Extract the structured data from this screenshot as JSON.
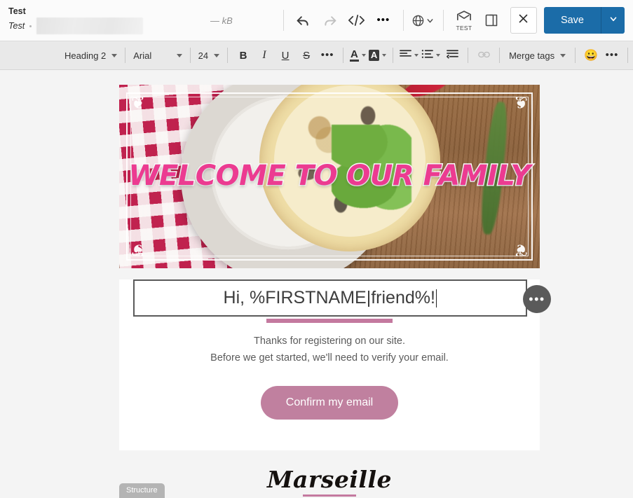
{
  "topbar": {
    "doc_title": "Test",
    "doc_subtitle": "Test",
    "size_label": "— kB",
    "undo_title": "Undo",
    "redo_title": "Redo",
    "code_label": "</>",
    "more_label": "•••",
    "language_icon": "globe-icon",
    "test_label": "TEST",
    "preview_icon": "device-preview-icon",
    "close_label": "✕",
    "save_label": "Save"
  },
  "format_toolbar": {
    "paragraph_style": "Heading 2",
    "font_family": "Arial",
    "font_size": "24",
    "bold": "B",
    "italic": "I",
    "underline": "U",
    "strikethrough": "S",
    "more_format": "•••",
    "text_color": "A",
    "highlight_color": "A",
    "align": "align-left-icon",
    "list": "bulleted-list-icon",
    "indent": "indent-icon",
    "link": "link-icon",
    "merge_tags": "Merge tags",
    "emoji": "😀",
    "more_tools": "•••"
  },
  "email": {
    "hero_text": "WELCOME TO OUR FAMILY",
    "heading_text": "Hi, %FIRSTNAME|friend%!",
    "body_line1": "Thanks for registering on our site.",
    "body_line2": "Before we get started, we'll need to verify your email.",
    "cta_label": "Confirm my email",
    "logo_text": "Marseille",
    "block_badge": "Structure",
    "handle_label": "•••"
  },
  "colors": {
    "save_blue": "#1b6ca8",
    "accent_pink": "#c4799f",
    "cta_pink": "#c0809f",
    "hero_pink": "#ec3b91",
    "toolbar_grey": "#e9e9e9",
    "canvas_grey": "#f4f4f4"
  }
}
